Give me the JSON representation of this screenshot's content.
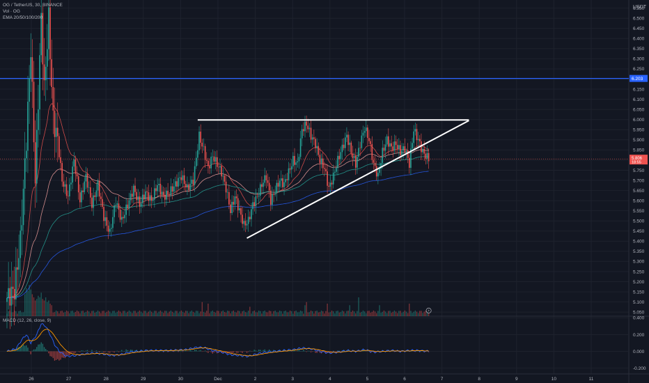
{
  "legend": {
    "symbol_line": "OG / TetherUS, 30, BINANCE",
    "vol_line": "Vol · OG",
    "ema_line": "EMA 20/50/100/200"
  },
  "macd_label": "MACD (12, 26, close, 9)",
  "currency": "USDT",
  "colors": {
    "background": "#131722",
    "up": "#26a69a",
    "down": "#ef5350",
    "grid": "#1e222d",
    "hline": "#2962ff",
    "trendline": "#ffffff",
    "ema20": "#ef5350",
    "ema50": "#f7a2a0",
    "ema100": "#26a69a",
    "ema200": "#2962ff",
    "macd": "#2962ff",
    "signal": "#ff9800"
  },
  "chart_data": {
    "type": "candlestick",
    "price_axis": {
      "ticks": [
        "6.550",
        "6.500",
        "6.450",
        "6.400",
        "6.350",
        "6.300",
        "6.250",
        "6.200",
        "6.150",
        "6.100",
        "6.050",
        "6.000",
        "5.950",
        "5.900",
        "5.850",
        "5.800",
        "5.750",
        "5.700",
        "5.650",
        "5.600",
        "5.550",
        "5.500",
        "5.450",
        "5.400",
        "5.350",
        "5.300",
        "5.250",
        "5.200",
        "5.150",
        "5.100",
        "5.050"
      ],
      "range": [
        5.03,
        6.59
      ]
    },
    "macd_axis": {
      "ticks": [
        "0.400",
        "0.200",
        "0.000",
        "-0.200"
      ],
      "range": [
        -0.27,
        0.42
      ]
    },
    "time_axis": {
      "ticks": [
        "26",
        "27",
        "28",
        "29",
        "30",
        "Dec",
        "2",
        "3",
        "4",
        "5",
        "6",
        "7",
        "8",
        "9",
        "10",
        "11"
      ]
    },
    "horizontal_line": {
      "price": 6.203,
      "label": "6.203"
    },
    "current_price": {
      "price": 5.806,
      "label": "5.806",
      "countdown": "18:55"
    },
    "last_bar_index": 283,
    "trendlines": [
      {
        "name": "resistance",
        "from": {
          "bar": 128,
          "price": 5.998
        },
        "to": {
          "bar": 310,
          "price": 5.998
        }
      },
      {
        "name": "support",
        "from": {
          "bar": 161,
          "price": 5.415
        },
        "to": {
          "bar": 310,
          "price": 5.995
        }
      }
    ],
    "series": [
      {
        "name": "EMA 20"
      },
      {
        "name": "EMA 50"
      },
      {
        "name": "EMA 100"
      },
      {
        "name": "EMA 200"
      }
    ],
    "anchors": [
      [
        0,
        5.12
      ],
      [
        5,
        5.16
      ],
      [
        9,
        5.4
      ],
      [
        13,
        5.9
      ],
      [
        16,
        6.35
      ],
      [
        19,
        5.7
      ],
      [
        23,
        6.5
      ],
      [
        25,
        6.15
      ],
      [
        28,
        6.5
      ],
      [
        31,
        6.0
      ],
      [
        34,
        5.9
      ],
      [
        37,
        5.7
      ],
      [
        41,
        5.62
      ],
      [
        45,
        5.8
      ],
      [
        49,
        5.6
      ],
      [
        53,
        5.72
      ],
      [
        57,
        5.58
      ],
      [
        61,
        5.68
      ],
      [
        65,
        5.52
      ],
      [
        69,
        5.44
      ],
      [
        73,
        5.6
      ],
      [
        77,
        5.5
      ],
      [
        81,
        5.58
      ],
      [
        85,
        5.66
      ],
      [
        89,
        5.58
      ],
      [
        93,
        5.64
      ],
      [
        97,
        5.6
      ],
      [
        101,
        5.68
      ],
      [
        105,
        5.62
      ],
      [
        109,
        5.64
      ],
      [
        113,
        5.68
      ],
      [
        117,
        5.72
      ],
      [
        121,
        5.66
      ],
      [
        125,
        5.7
      ],
      [
        129,
        5.92
      ],
      [
        132,
        5.85
      ],
      [
        135,
        5.76
      ],
      [
        138,
        5.82
      ],
      [
        141,
        5.78
      ],
      [
        144,
        5.74
      ],
      [
        147,
        5.66
      ],
      [
        150,
        5.55
      ],
      [
        153,
        5.62
      ],
      [
        156,
        5.55
      ],
      [
        159,
        5.48
      ],
      [
        162,
        5.5
      ],
      [
        165,
        5.58
      ],
      [
        168,
        5.62
      ],
      [
        171,
        5.68
      ],
      [
        174,
        5.72
      ],
      [
        177,
        5.6
      ],
      [
        180,
        5.65
      ],
      [
        183,
        5.7
      ],
      [
        186,
        5.68
      ],
      [
        189,
        5.74
      ],
      [
        192,
        5.8
      ],
      [
        195,
        5.78
      ],
      [
        198,
        5.95
      ],
      [
        201,
        5.98
      ],
      [
        204,
        5.92
      ],
      [
        207,
        5.88
      ],
      [
        210,
        5.8
      ],
      [
        213,
        5.76
      ],
      [
        216,
        5.66
      ],
      [
        219,
        5.72
      ],
      [
        222,
        5.8
      ],
      [
        225,
        5.86
      ],
      [
        228,
        5.92
      ],
      [
        231,
        5.84
      ],
      [
        234,
        5.78
      ],
      [
        237,
        5.88
      ],
      [
        240,
        5.96
      ],
      [
        243,
        5.9
      ],
      [
        246,
        5.78
      ],
      [
        249,
        5.72
      ],
      [
        252,
        5.84
      ],
      [
        255,
        5.9
      ],
      [
        258,
        5.86
      ],
      [
        261,
        5.88
      ],
      [
        264,
        5.84
      ],
      [
        267,
        5.86
      ],
      [
        270,
        5.78
      ],
      [
        273,
        5.95
      ],
      [
        276,
        5.9
      ],
      [
        279,
        5.84
      ],
      [
        283,
        5.806
      ]
    ],
    "volume_spikes": [
      [
        12,
        0.7
      ],
      [
        13,
        0.9
      ],
      [
        14,
        0.8
      ],
      [
        15,
        1.0
      ],
      [
        16,
        0.85
      ],
      [
        17,
        0.7
      ],
      [
        18,
        0.6
      ],
      [
        19,
        0.5
      ],
      [
        20,
        0.55
      ],
      [
        21,
        0.65
      ],
      [
        22,
        0.6
      ],
      [
        23,
        0.75
      ],
      [
        24,
        0.55
      ],
      [
        25,
        0.5
      ],
      [
        26,
        0.6
      ],
      [
        27,
        0.45
      ],
      [
        28,
        0.5
      ],
      [
        29,
        0.4
      ],
      [
        30,
        0.35
      ],
      [
        131,
        0.45
      ],
      [
        135,
        0.4
      ],
      [
        163,
        0.3
      ],
      [
        200,
        0.35
      ],
      [
        201,
        0.45
      ],
      [
        215,
        0.4
      ],
      [
        230,
        0.35
      ],
      [
        236,
        0.6
      ],
      [
        250,
        0.35
      ],
      [
        270,
        0.4
      ]
    ],
    "macd_anchors": [
      [
        0,
        0.0
      ],
      [
        6,
        0.03
      ],
      [
        10,
        0.14
      ],
      [
        13,
        0.2
      ],
      [
        16,
        0.1
      ],
      [
        20,
        0.2
      ],
      [
        23,
        0.33
      ],
      [
        26,
        0.3
      ],
      [
        29,
        0.2
      ],
      [
        32,
        0.08
      ],
      [
        35,
        0.0
      ],
      [
        40,
        -0.06
      ],
      [
        46,
        -0.05
      ],
      [
        52,
        -0.03
      ],
      [
        58,
        -0.02
      ],
      [
        64,
        -0.03
      ],
      [
        70,
        -0.05
      ],
      [
        76,
        -0.04
      ],
      [
        82,
        -0.01
      ],
      [
        88,
        0.0
      ],
      [
        94,
        0.01
      ],
      [
        100,
        0.01
      ],
      [
        110,
        0.01
      ],
      [
        120,
        0.02
      ],
      [
        128,
        0.05
      ],
      [
        133,
        0.04
      ],
      [
        138,
        0.01
      ],
      [
        144,
        -0.01
      ],
      [
        150,
        -0.04
      ],
      [
        156,
        -0.05
      ],
      [
        162,
        -0.06
      ],
      [
        168,
        -0.03
      ],
      [
        174,
        -0.01
      ],
      [
        180,
        0.0
      ],
      [
        186,
        0.01
      ],
      [
        192,
        0.02
      ],
      [
        198,
        0.04
      ],
      [
        204,
        0.03
      ],
      [
        210,
        0.0
      ],
      [
        216,
        -0.02
      ],
      [
        222,
        -0.01
      ],
      [
        228,
        0.01
      ],
      [
        234,
        0.0
      ],
      [
        240,
        0.02
      ],
      [
        246,
        -0.01
      ],
      [
        252,
        0.0
      ],
      [
        258,
        0.01
      ],
      [
        264,
        0.0
      ],
      [
        270,
        0.01
      ],
      [
        276,
        0.01
      ],
      [
        283,
        0.0
      ]
    ]
  }
}
